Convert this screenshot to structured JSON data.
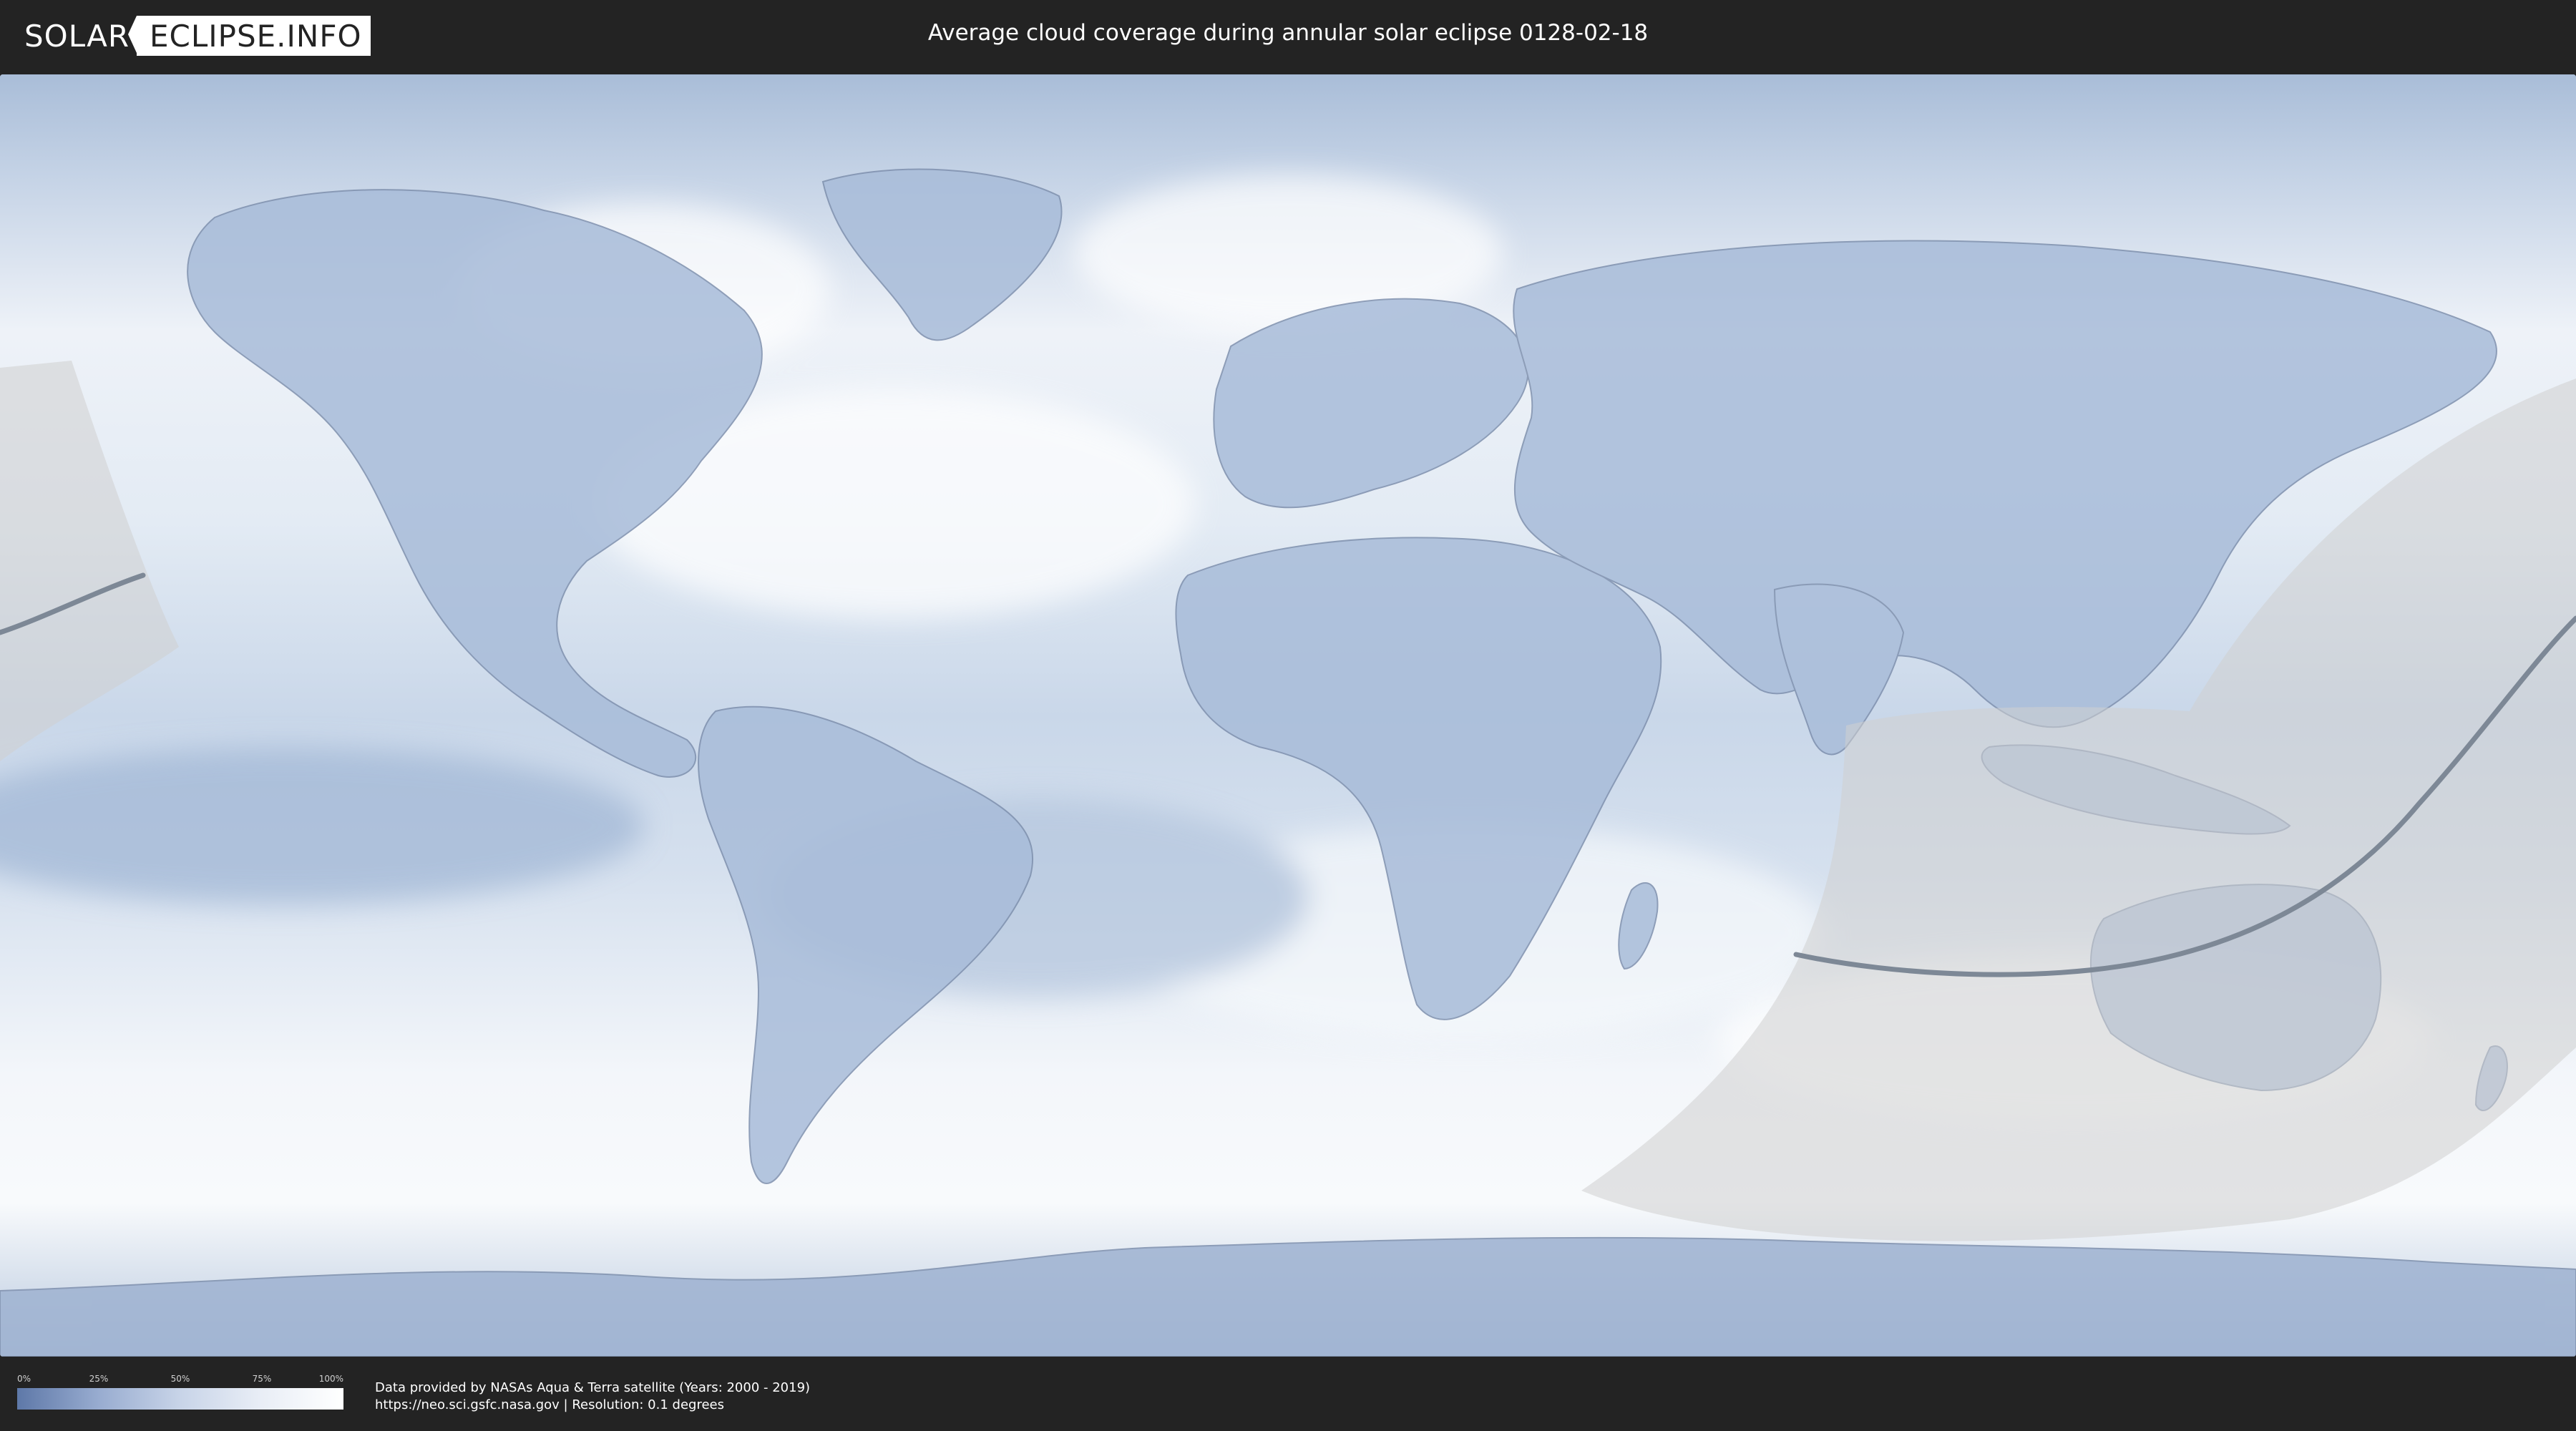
{
  "header": {
    "logo": {
      "part1": "SOLAR",
      "part2": "ECLIPSE.INFO"
    },
    "title": "Average cloud coverage during annular solar eclipse 0128-02-18"
  },
  "map": {
    "style": "cloud-coverage-equirectangular",
    "icons": [
      "eclipse-path-shading",
      "central-line"
    ]
  },
  "legend": {
    "ticks": [
      "0%",
      "25%",
      "50%",
      "75%",
      "100%"
    ],
    "gradient_colors": [
      "#5e78a8",
      "#98acd0",
      "#c8d4e8",
      "#e9eef6",
      "#ffffff"
    ]
  },
  "credits": {
    "line1": "Data provided by NASAs Aqua & Terra satellite (Years: 2000 - 2019)",
    "line2": "https://neo.sci.gsfc.nasa.gov | Resolution: 0.1 degrees"
  },
  "colors": {
    "background": "#232323",
    "land": "#9fb3d4",
    "ocean_clouds": "#dfe7f1",
    "shade": "#d9d9d9"
  }
}
